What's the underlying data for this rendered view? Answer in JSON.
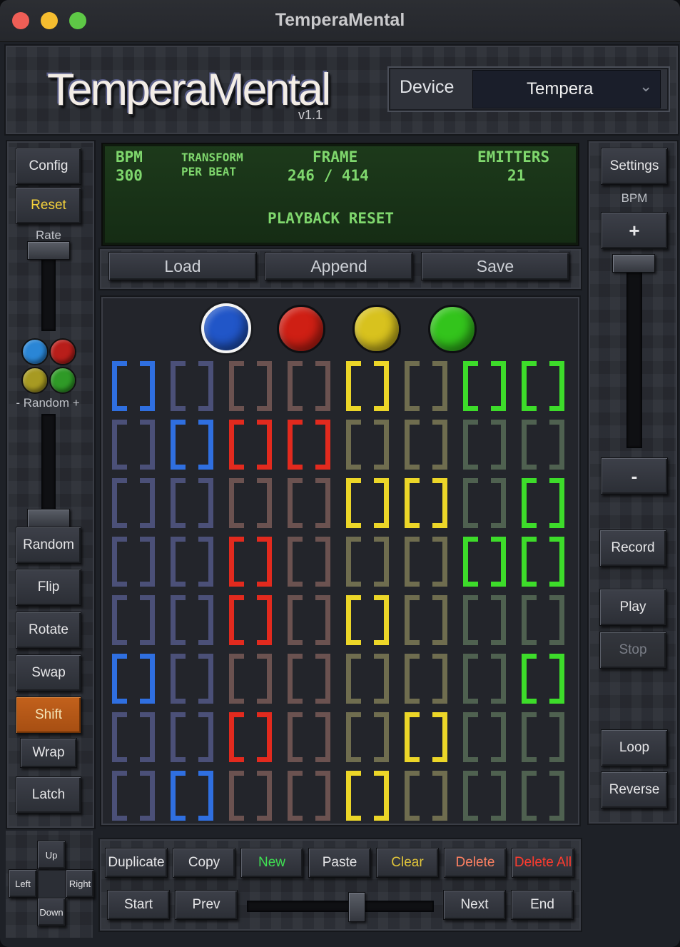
{
  "window": {
    "title": "TemperaMental"
  },
  "header": {
    "logo": "TemperaMental",
    "version": "v1.1",
    "device_label": "Device",
    "device_value": "Tempera"
  },
  "left": {
    "config": "Config",
    "reset": "Reset",
    "rate_label": "Rate",
    "random_label": "- Random +",
    "random": "Random",
    "flip": "Flip",
    "rotate": "Rotate",
    "swap": "Swap",
    "shift": "Shift",
    "wrap": "Wrap",
    "latch": "Latch",
    "dot_colors": [
      "#2a86d6",
      "#b81e1a",
      "#a79a22",
      "#2f9a27"
    ],
    "rate_value": 1.0,
    "random_value": 0.0
  },
  "lcd": {
    "bpm_label": "BPM",
    "bpm_value": "300",
    "transform_label": "TRANSFORM",
    "per_beat_label": "PER BEAT",
    "frame_label": "FRAME",
    "frame_value": "246 / 414",
    "emitters_label": "EMITTERS",
    "emitters_value": "21",
    "status": "PLAYBACK RESET"
  },
  "file_buttons": {
    "load": "Load",
    "append": "Append",
    "save": "Save"
  },
  "emitters": [
    {
      "color": "#2156c8",
      "selected": true
    },
    {
      "color": "#cf1f14",
      "selected": false
    },
    {
      "color": "#d8c21e",
      "selected": false
    },
    {
      "color": "#33c41c",
      "selected": false
    }
  ],
  "grid": {
    "active_colors": [
      "#2f6fe0",
      "#e22a1e",
      "#ecd628",
      "#3ddc2a"
    ],
    "dim_colors": [
      "#4b5078",
      "#4b5078",
      "#6b5250",
      "#6b5250",
      "#6f6d4f",
      "#6f6d4f",
      "#4f6150",
      "#4f6150"
    ],
    "rows": [
      [
        1,
        0,
        0,
        0,
        3,
        0,
        4,
        4
      ],
      [
        0,
        1,
        2,
        2,
        0,
        0,
        0,
        0
      ],
      [
        0,
        0,
        0,
        0,
        3,
        3,
        0,
        4
      ],
      [
        0,
        0,
        2,
        0,
        0,
        0,
        4,
        4
      ],
      [
        0,
        0,
        2,
        0,
        3,
        0,
        0,
        0
      ],
      [
        1,
        0,
        0,
        0,
        0,
        0,
        0,
        4
      ],
      [
        0,
        0,
        2,
        0,
        0,
        3,
        0,
        0
      ],
      [
        0,
        1,
        0,
        0,
        3,
        0,
        0,
        0
      ]
    ]
  },
  "right": {
    "settings": "Settings",
    "bpm_label": "BPM",
    "plus": "+",
    "minus": "-",
    "record": "Record",
    "play": "Play",
    "stop": "Stop",
    "loop": "Loop",
    "reverse": "Reverse",
    "bpm_slider_value": 1.0
  },
  "nav": {
    "up": "Up",
    "left": "Left",
    "right": "Right",
    "down": "Down"
  },
  "bottom": {
    "duplicate": "Duplicate",
    "copy": "Copy",
    "new": "New",
    "paste": "Paste",
    "clear": "Clear",
    "delete": "Delete",
    "delete_all": "Delete All",
    "start": "Start",
    "prev": "Prev",
    "next": "Next",
    "end": "End",
    "frame_slider_value": 0.59
  }
}
